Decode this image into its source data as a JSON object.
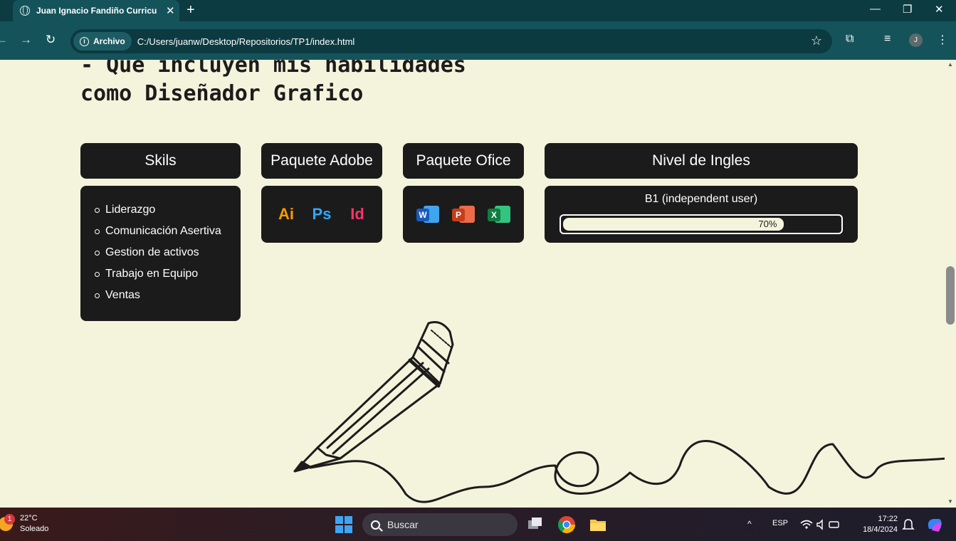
{
  "browser": {
    "tab_title": "Juan Ignacio Fandiño Curriculum",
    "close_tab_glyph": "✕",
    "new_tab_glyph": "+",
    "security_chip": "Archivo",
    "url": "C:/Users/juanw/Desktop/Repositorios/TP1/index.html",
    "profile_initial": "J",
    "window_minimize": "—",
    "window_restore": "❐",
    "window_close": "✕",
    "back_glyph": "←",
    "forward_glyph": "→",
    "reload_glyph": "↻",
    "star_glyph": "☆",
    "extensions_glyph": "⧉",
    "media_glyph": "≡",
    "menu_glyph": "⋮"
  },
  "page": {
    "heading_line1": "- Que incluyen mis habilidades",
    "heading_line2": "como Diseñador Grafico",
    "skills": {
      "title": "Skils",
      "items": [
        "Liderazgo",
        "Comunicación Asertiva",
        "Gestion de activos",
        "Trabajo en Equipo",
        "Ventas"
      ]
    },
    "adobe": {
      "title": "Paquete Adobe",
      "icons": [
        {
          "name": "illustrator-icon",
          "label": "Ai",
          "color": "#ff9a00"
        },
        {
          "name": "photoshop-icon",
          "label": "Ps",
          "color": "#31a8ff"
        },
        {
          "name": "indesign-icon",
          "label": "Id",
          "color": "#ff3366"
        }
      ]
    },
    "office": {
      "title": "Paquete Ofice",
      "icons": [
        {
          "name": "word-icon",
          "label": "W",
          "color": "#185abd"
        },
        {
          "name": "powerpoint-icon",
          "label": "P",
          "color": "#c43e1c"
        },
        {
          "name": "excel-icon",
          "label": "X",
          "color": "#107c41"
        }
      ]
    },
    "english": {
      "title": "Nivel de Ingles",
      "level": "B1 (independent user)",
      "progress_text": "70%",
      "progress_value": 0.8
    }
  },
  "taskbar": {
    "weather_temp": "22°C",
    "weather_desc": "Soleado",
    "weather_badge": "1",
    "search_placeholder": "Buscar",
    "language": "ESP",
    "time": "17:22",
    "date": "18/4/2024",
    "tray_arrow": "^"
  }
}
